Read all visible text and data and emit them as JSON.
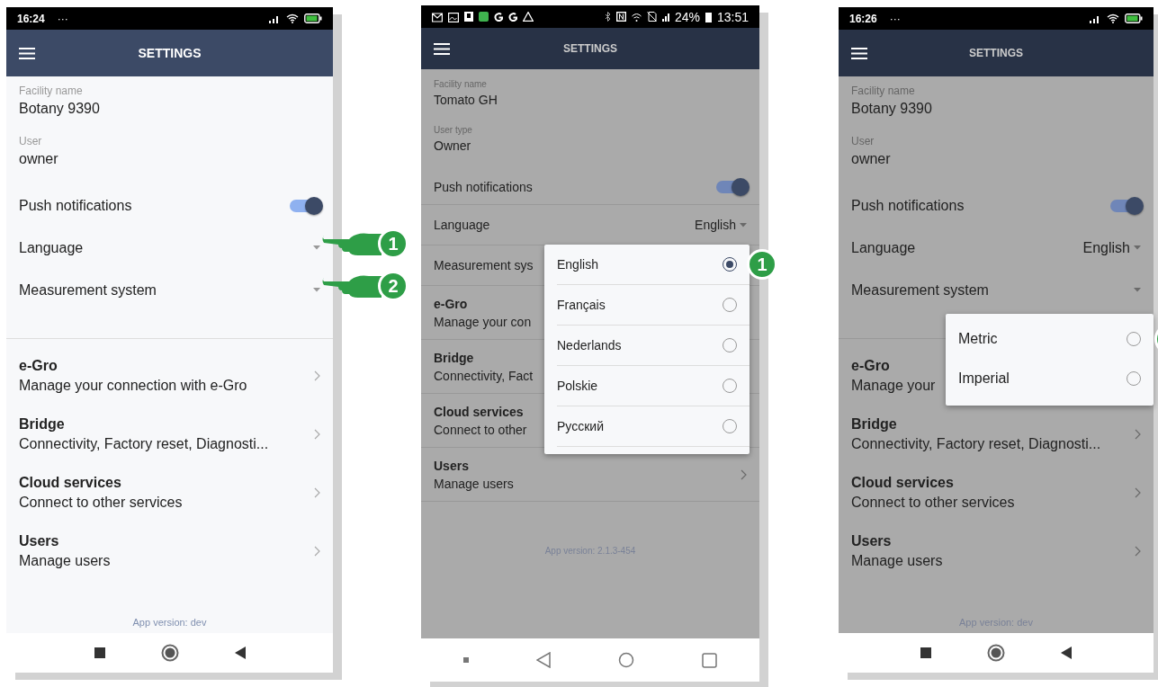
{
  "phones": [
    {
      "kind": "large",
      "dimmed": false,
      "status_bar": {
        "kind": "simple",
        "time": "16:24",
        "dots": "···"
      },
      "header": {
        "title": "SETTINGS"
      },
      "fields": [
        {
          "label": "Facility name",
          "value": "Botany 9390"
        },
        {
          "label": "User",
          "value": "owner"
        }
      ],
      "push": {
        "label": "Push notifications",
        "on": true
      },
      "selects": [
        {
          "label": "Language",
          "caret": true,
          "callout": {
            "kind": "hand",
            "number": "1"
          }
        },
        {
          "label": "Measurement system",
          "caret": true,
          "callout": {
            "kind": "hand",
            "number": "2"
          }
        }
      ],
      "links": [
        {
          "title": "e-Gro",
          "subtitle": "Manage your connection with e-Gro"
        },
        {
          "title": "Bridge",
          "subtitle": "Connectivity, Factory reset, Diagnosti..."
        },
        {
          "title": "Cloud services",
          "subtitle": "Connect to other services"
        },
        {
          "title": "Users",
          "subtitle": "Manage users"
        }
      ],
      "version": "App version: dev",
      "nav_bar": {
        "kind": "filled"
      }
    },
    {
      "kind": "compact",
      "dimmed": true,
      "status_bar": {
        "kind": "notifications",
        "battery": "24%",
        "time": "13:51"
      },
      "header": {
        "title": "SETTINGS"
      },
      "fields": [
        {
          "label": "Facility name",
          "value": "Tomato GH"
        },
        {
          "label": "User type",
          "value": "Owner"
        }
      ],
      "push": {
        "label": "Push notifications",
        "on": true
      },
      "selects": [
        {
          "label": "Language",
          "value": "English",
          "popup": {
            "options": [
              {
                "label": "English",
                "selected": true,
                "callout": {
                  "kind": "badge",
                  "number": "1"
                }
              },
              {
                "label": "Français",
                "selected": false
              },
              {
                "label": "Nederlands",
                "selected": false
              },
              {
                "label": "Polskie",
                "selected": false
              },
              {
                "label": "Русский",
                "selected": false
              }
            ]
          },
          "caret": true
        },
        {
          "label": "Measurement sys"
        }
      ],
      "links": [
        {
          "title": "e-Gro",
          "subtitle": "Manage your con"
        },
        {
          "title": "Bridge",
          "subtitle": "Connectivity, Fact"
        },
        {
          "title": "Cloud services",
          "subtitle": "Connect to other"
        },
        {
          "title": "Users",
          "subtitle": "Manage users"
        }
      ],
      "version": "App version: 2.1.3-454",
      "nav_bar": {
        "kind": "outline"
      }
    },
    {
      "kind": "large",
      "dimmed": true,
      "status_bar": {
        "kind": "simple",
        "time": "16:26",
        "dots": "···"
      },
      "header": {
        "title": "SETTINGS"
      },
      "fields": [
        {
          "label": "Facility name",
          "value": "Botany 9390"
        },
        {
          "label": "User",
          "value": "owner"
        }
      ],
      "push": {
        "label": "Push notifications",
        "on": true
      },
      "selects": [
        {
          "label": "Language",
          "value": "English",
          "caret": true
        },
        {
          "label": "Measurement system",
          "caret": true,
          "popup": {
            "options": [
              {
                "label": "Metric",
                "selected": false,
                "callout": {
                  "kind": "badge"
                }
              },
              {
                "label": "Imperial",
                "selected": false
              }
            ]
          }
        }
      ],
      "links": [
        {
          "title": "e-Gro",
          "subtitle": "Manage your"
        },
        {
          "title": "Bridge",
          "subtitle": "Connectivity, Factory reset, Diagnosti..."
        },
        {
          "title": "Cloud services",
          "subtitle": "Connect to other services"
        },
        {
          "title": "Users",
          "subtitle": "Manage users"
        }
      ],
      "version": "App version: dev",
      "nav_bar": {
        "kind": "filled"
      }
    }
  ]
}
